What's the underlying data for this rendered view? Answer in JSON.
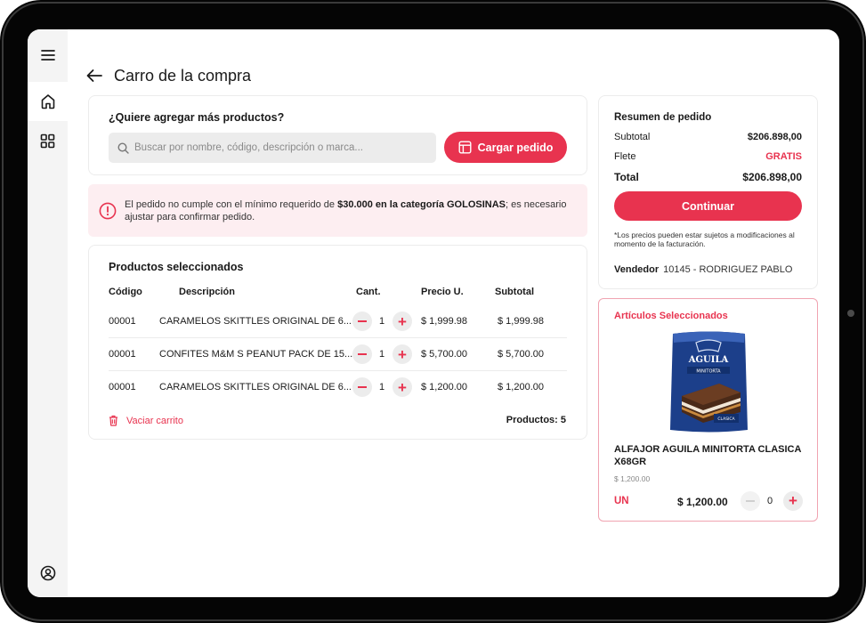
{
  "header": {
    "title": "Carro de la compra"
  },
  "add_products": {
    "title": "¿Quiere agregar más productos?",
    "search_placeholder": "Buscar por nombre, código, descripción o marca...",
    "load_button": "Cargar pedido"
  },
  "alert": {
    "text_prefix": "El pedido no cumple con el mínimo requerido de ",
    "text_bold": "$30.000 en la categoría GOLOSINAS",
    "text_suffix": "; es necesario ajustar para confirmar pedido."
  },
  "products": {
    "title": "Productos seleccionados",
    "columns": {
      "code": "Código",
      "description": "Descripción",
      "qty": "Cant.",
      "unit_price": "Precio U.",
      "subtotal": "Subtotal"
    },
    "rows": [
      {
        "code": "00001",
        "description": "CARAMELOS SKITTLES ORIGINAL DE 6...",
        "qty": "1",
        "unit_price": "$ 1,999.98",
        "subtotal": "$ 1,999.98"
      },
      {
        "code": "00001",
        "description": "CONFITES M&M S PEANUT PACK DE 15...",
        "qty": "1",
        "unit_price": "$ 5,700.00",
        "subtotal": "$ 5,700.00"
      },
      {
        "code": "00001",
        "description": "CARAMELOS SKITTLES ORIGINAL DE 6...",
        "qty": "1",
        "unit_price": "$ 1,200.00",
        "subtotal": "$ 1,200.00"
      }
    ],
    "empty_cart": "Vaciar carrito",
    "count_label": "Productos: 5"
  },
  "summary": {
    "title": "Resumen de pedido",
    "subtotal_label": "Subtotal",
    "subtotal_value": "$206.898,00",
    "freight_label": "Flete",
    "freight_value": "GRATIS",
    "total_label": "Total",
    "total_value": "$206.898,00",
    "continue_button": "Continuar",
    "disclaimer": "*Los precios pueden estar sujetos a modificaciones al momento de la  facturación.",
    "seller_label": "Vendedor",
    "seller_value": "10145 - RODRIGUEZ PABLO"
  },
  "selected_article": {
    "title": "Artículos Seleccionados",
    "name": "ALFAJOR AGUILA MINITORTA CLASICA X68GR",
    "price_small": "$ 1,200.00",
    "unit": "UN",
    "price": "$ 1,200.00",
    "qty": "0",
    "package_brand": "AGUILA",
    "package_sub": "MINITORTA",
    "package_variant": "CLASICA"
  },
  "colors": {
    "accent": "#e8334f",
    "alert_bg": "#fdeef1",
    "sidebar_bg": "#f4f4f4"
  }
}
